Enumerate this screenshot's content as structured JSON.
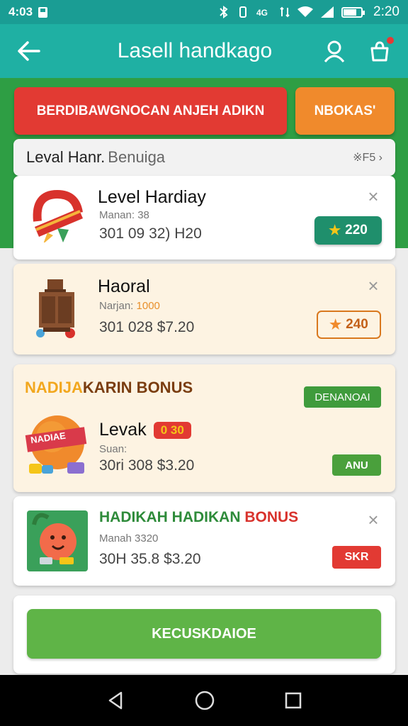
{
  "status_bar": {
    "left_text": "4:03",
    "time": "2:20",
    "battery_level": 0.75
  },
  "app_bar": {
    "title": "Lasell handkago",
    "back_icon": "arrow-left-icon",
    "profile_icon": "user-icon",
    "bag_icon": "shopping-bag-icon",
    "has_notification": true
  },
  "actions": {
    "primary_label": "BERDIBAWGNOCAN ANJEH ADIKN",
    "primary_color": "#e23a33",
    "secondary_label": "NBOKAS'",
    "secondary_color": "#f08a2c"
  },
  "list_header": {
    "title": "Leval Hanr.",
    "muted": "Benuiga",
    "more": "※F5 ›"
  },
  "items": [
    {
      "title": "Level Hardiay",
      "sub": "Manan: 38",
      "meta": "301 09 32) H20",
      "badge": "220",
      "badge_icon": "star-icon"
    },
    {
      "title": "Haoral",
      "sub_label": "Narjan:",
      "sub_highlight": "1000",
      "meta": "301 028 $7.20",
      "badge": "240",
      "badge_icon": "star-icon"
    }
  ],
  "bonus_card": {
    "heading_a": "NADIJA",
    "heading_b": "KARIN BONUS",
    "tag": "DENANOAI",
    "banner_text": "NADIAE",
    "title": "Levak",
    "title_badge": "0 30",
    "sub": "Suan:",
    "meta": "30ri 308 $3.20",
    "button": "ANU"
  },
  "hadikah_card": {
    "title_a": "HADIKAH HADIKAN",
    "title_b": "BONUS",
    "sub": "Manah 3320",
    "meta": "30H 35.8 $3.20",
    "button": "SKR"
  },
  "footer": {
    "button_label": "KECUSKDAIOE"
  },
  "nav": {
    "back": "triangle-back-icon",
    "home": "circle-home-icon",
    "recents": "square-recents-icon"
  }
}
